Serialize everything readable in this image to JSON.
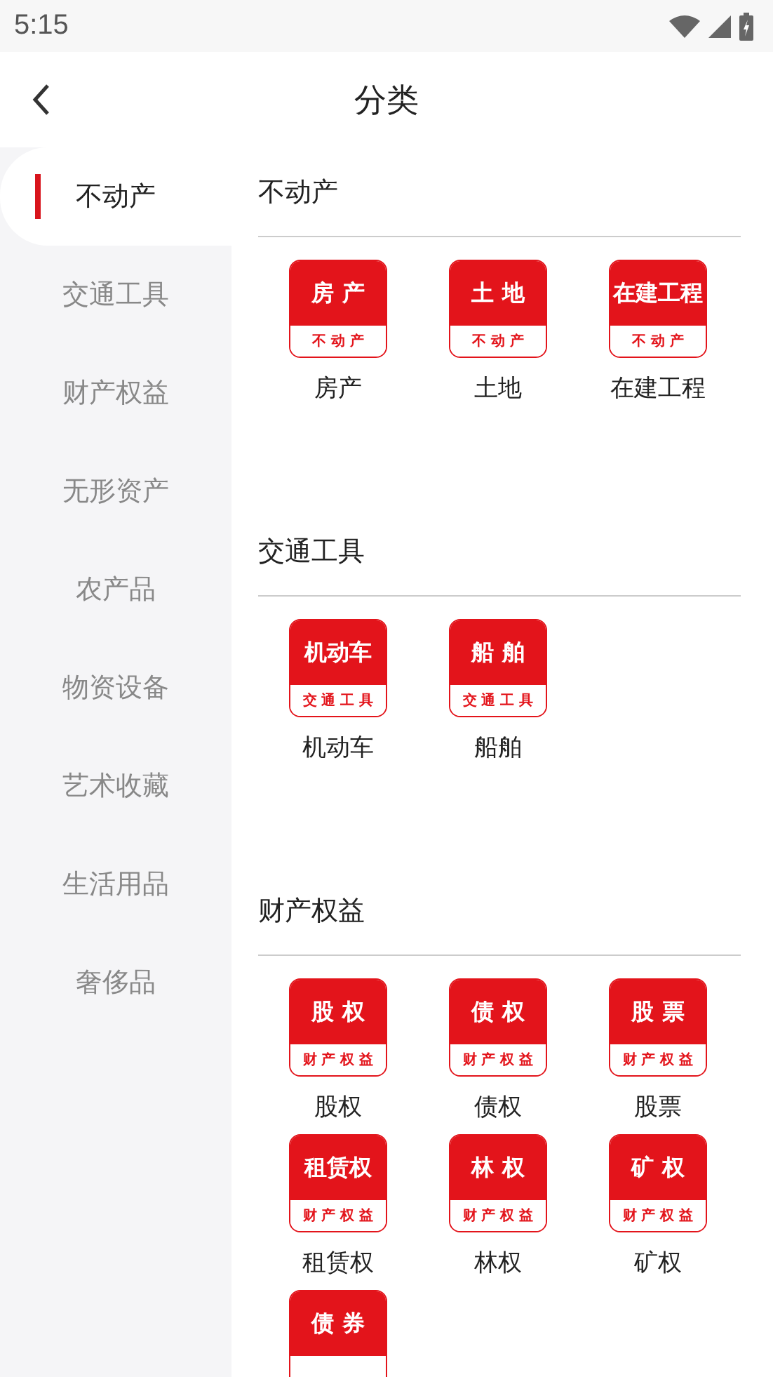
{
  "status_bar": {
    "time": "5:15"
  },
  "header": {
    "title": "分类"
  },
  "sidebar": {
    "items": [
      {
        "label": "不动产",
        "selected": true
      },
      {
        "label": "交通工具",
        "selected": false
      },
      {
        "label": "财产权益",
        "selected": false
      },
      {
        "label": "无形资产",
        "selected": false
      },
      {
        "label": "农产品",
        "selected": false
      },
      {
        "label": "物资设备",
        "selected": false
      },
      {
        "label": "艺术收藏",
        "selected": false
      },
      {
        "label": "生活用品",
        "selected": false
      },
      {
        "label": "奢侈品",
        "selected": false
      }
    ]
  },
  "sections": [
    {
      "title": "不动产",
      "items": [
        {
          "tile_title": "房 产",
          "tile_subtitle": "不 动 产",
          "label": "房产"
        },
        {
          "tile_title": "土 地",
          "tile_subtitle": "不 动 产",
          "label": "土地"
        },
        {
          "tile_title": "在建工程",
          "tile_subtitle": "不 动 产",
          "label": "在建工程"
        }
      ]
    },
    {
      "title": "交通工具",
      "items": [
        {
          "tile_title": "机动车",
          "tile_subtitle": "交 通 工 具",
          "label": "机动车"
        },
        {
          "tile_title": "船 舶",
          "tile_subtitle": "交 通 工 具",
          "label": "船舶"
        }
      ]
    },
    {
      "title": "财产权益",
      "items": [
        {
          "tile_title": "股 权",
          "tile_subtitle": "财 产 权 益",
          "label": "股权"
        },
        {
          "tile_title": "债 权",
          "tile_subtitle": "财 产 权 益",
          "label": "债权"
        },
        {
          "tile_title": "股 票",
          "tile_subtitle": "财 产 权 益",
          "label": "股票"
        },
        {
          "tile_title": "租赁权",
          "tile_subtitle": "财 产 权 益",
          "label": "租赁权"
        },
        {
          "tile_title": "林 权",
          "tile_subtitle": "财 产 权 益",
          "label": "林权"
        },
        {
          "tile_title": "矿 权",
          "tile_subtitle": "财 产 权 益",
          "label": "矿权"
        },
        {
          "tile_title": "债 券"
        }
      ]
    }
  ]
}
